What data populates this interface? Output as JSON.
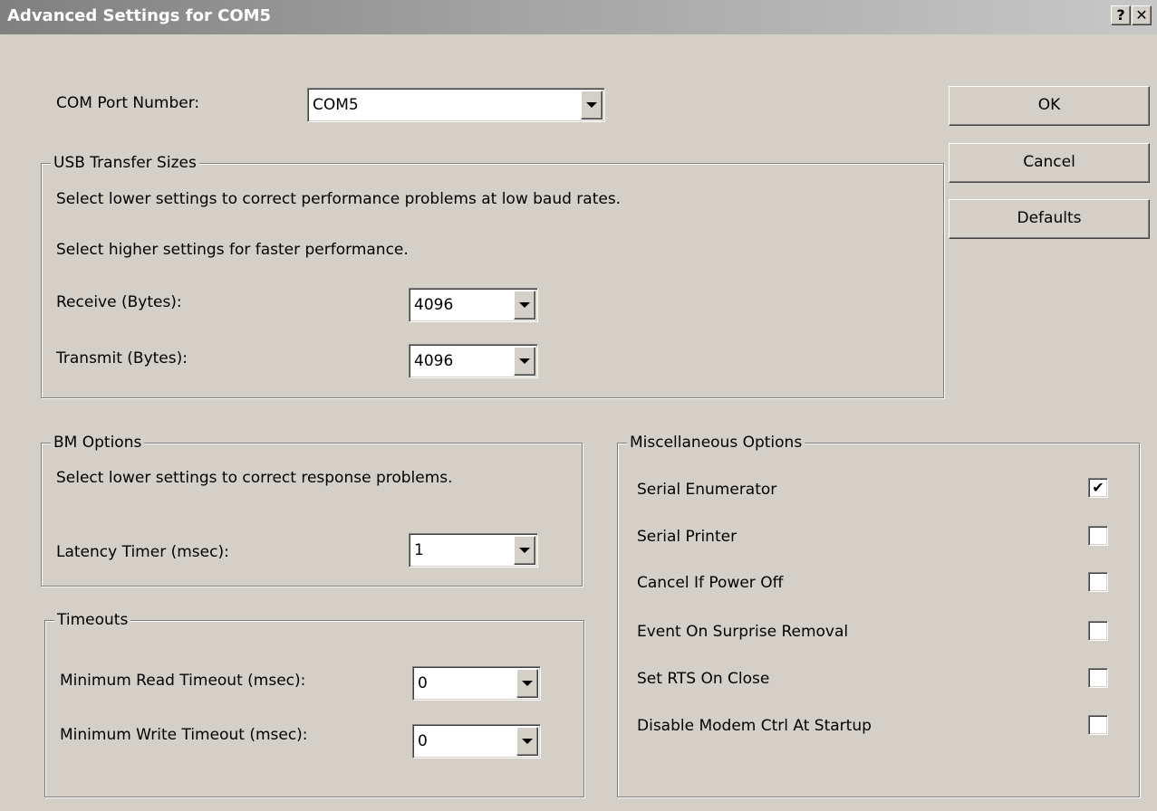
{
  "window": {
    "title": "Advanced Settings for COM5",
    "help_glyph": "?",
    "close_glyph": "✕"
  },
  "com_port": {
    "label": "COM Port Number:",
    "value": "COM5"
  },
  "usb_transfer": {
    "title": "USB Transfer Sizes",
    "hint_low": "Select lower settings to correct performance problems at low baud rates.",
    "hint_high": "Select higher settings for faster performance.",
    "receive_label": "Receive (Bytes):",
    "receive_value": "4096",
    "transmit_label": "Transmit (Bytes):",
    "transmit_value": "4096"
  },
  "bm_options": {
    "title": "BM Options",
    "hint": "Select lower settings to correct response problems.",
    "latency_label": "Latency Timer (msec):",
    "latency_value": "1"
  },
  "timeouts": {
    "title": "Timeouts",
    "read_label": "Minimum Read Timeout (msec):",
    "read_value": "0",
    "write_label": "Minimum Write Timeout (msec):",
    "write_value": "0"
  },
  "misc": {
    "title": "Miscellaneous Options",
    "options": [
      {
        "label": "Serial Enumerator",
        "mark": "✔"
      },
      {
        "label": "Serial Printer",
        "mark": ""
      },
      {
        "label": "Cancel If Power Off",
        "mark": ""
      },
      {
        "label": "Event On Surprise Removal",
        "mark": ""
      },
      {
        "label": "Set RTS On Close",
        "mark": ""
      },
      {
        "label": "Disable Modem Ctrl At Startup",
        "mark": ""
      }
    ]
  },
  "buttons": {
    "ok": "OK",
    "cancel": "Cancel",
    "defaults": "Defaults"
  }
}
